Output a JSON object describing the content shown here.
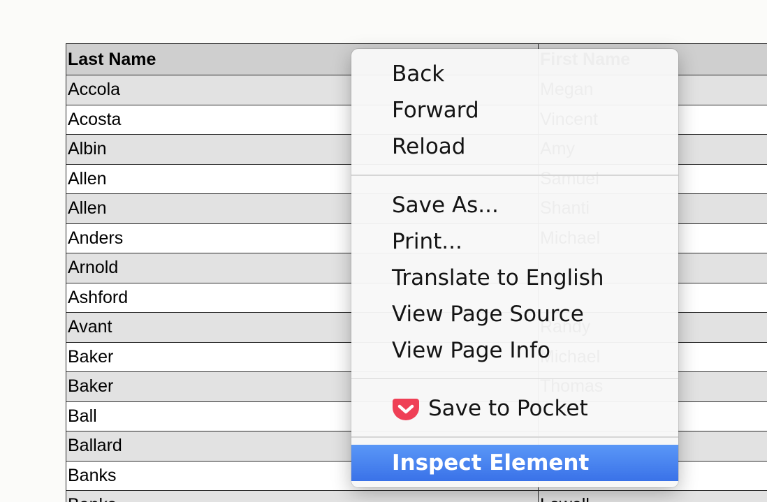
{
  "table": {
    "headers": [
      "Last Name",
      "First Name"
    ],
    "rows": [
      [
        "Accola",
        "Megan"
      ],
      [
        "Acosta",
        "Vincent"
      ],
      [
        "Albin",
        "Amy"
      ],
      [
        "Allen",
        "Samuel"
      ],
      [
        "Allen",
        "Shanti"
      ],
      [
        "Anders",
        "Michael"
      ],
      [
        "Arnold",
        ""
      ],
      [
        "Ashford",
        ""
      ],
      [
        "Avant",
        "Randy"
      ],
      [
        "Baker",
        "Michael"
      ],
      [
        "Baker",
        "Thomas"
      ],
      [
        "Ball",
        ""
      ],
      [
        "Ballard",
        ""
      ],
      [
        "Banks",
        ""
      ],
      [
        "Banks",
        "Lowell"
      ]
    ]
  },
  "context_menu": {
    "group1": [
      "Back",
      "Forward",
      "Reload"
    ],
    "group2": [
      "Save As...",
      "Print...",
      "Translate to English",
      "View Page Source",
      "View Page Info"
    ],
    "pocket": {
      "label": "Save to Pocket",
      "icon": "pocket-icon",
      "color": "#ef4056"
    },
    "inspect": {
      "label": "Inspect Element",
      "highlight_color": "#4a84f0"
    }
  }
}
